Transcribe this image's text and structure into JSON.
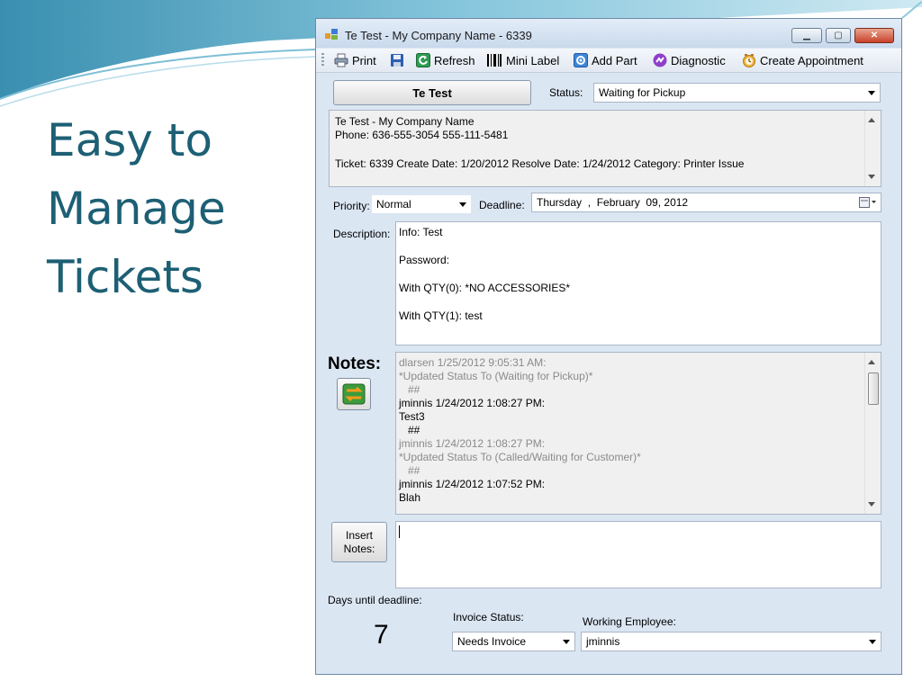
{
  "slide": {
    "title_lines": [
      "Easy to",
      "Manage",
      "Tickets"
    ]
  },
  "window": {
    "title": "Te Test - My Company Name - 6339",
    "controls": {
      "minimize": "▁",
      "maximize": "▢",
      "close": "✕"
    }
  },
  "toolbar": {
    "print": "Print",
    "refresh": "Refresh",
    "mini_label": "Mini Label",
    "add_part": "Add Part",
    "diagnostic": "Diagnostic",
    "create_appointment": "Create Appointment"
  },
  "customer_button": "Te Test",
  "status": {
    "label": "Status:",
    "value": "Waiting for Pickup"
  },
  "info": {
    "line1": "Te Test - My Company Name",
    "line2": "Phone: 636-555-3054 555-111-5481",
    "line3": "Ticket: 6339 Create Date: 1/20/2012 Resolve Date: 1/24/2012 Category: Printer Issue"
  },
  "priority": {
    "label": "Priority:",
    "value": "Normal"
  },
  "deadline": {
    "label": "Deadline:",
    "value": "Thursday  ,  February  09, 2012"
  },
  "description": {
    "label": "Description:",
    "lines": [
      "Info: Test",
      "Password:",
      "With QTY(0): *NO ACCESSORIES*",
      "With QTY(1): test"
    ]
  },
  "notes": {
    "label": "Notes:",
    "entries": [
      {
        "text": "dlarsen 1/25/2012 9:05:31 AM:",
        "style": "gray"
      },
      {
        "text": "*Updated Status To (Waiting for Pickup)*",
        "style": "gray"
      },
      {
        "text": "   ##",
        "style": "gray"
      },
      {
        "text": "jminnis 1/24/2012 1:08:27 PM:",
        "style": "normal"
      },
      {
        "text": "Test3",
        "style": "normal"
      },
      {
        "text": "   ##",
        "style": "normal"
      },
      {
        "text": "jminnis 1/24/2012 1:08:27 PM:",
        "style": "gray"
      },
      {
        "text": "*Updated Status To (Called/Waiting for Customer)*",
        "style": "gray"
      },
      {
        "text": "   ##",
        "style": "gray"
      },
      {
        "text": "jminnis 1/24/2012 1:07:52 PM:",
        "style": "normal"
      },
      {
        "text": "Blah",
        "style": "normal"
      }
    ]
  },
  "insert_notes_button": [
    "Insert",
    "Notes:"
  ],
  "insert_notes_value": "",
  "days_until_deadline": {
    "label": "Days until deadline:",
    "value": "7"
  },
  "invoice_status": {
    "label": "Invoice Status:",
    "value": "Needs Invoice"
  },
  "working_employee": {
    "label": "Working Employee:",
    "value": "jminnis"
  },
  "colors": {
    "title": "#1d5f74",
    "window_bg": "#dbe6f3"
  }
}
